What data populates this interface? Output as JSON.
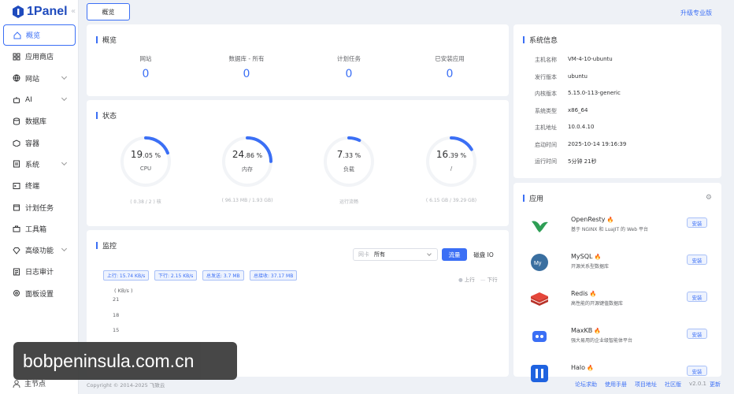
{
  "app": {
    "brand": "1Panel",
    "accent": "#3b6ff5"
  },
  "sidebar": {
    "items": [
      {
        "label": "概览",
        "icon": "home-icon",
        "active": true,
        "sub": false
      },
      {
        "label": "应用商店",
        "icon": "grid-icon",
        "sub": false
      },
      {
        "label": "网站",
        "icon": "globe-icon",
        "sub": true
      },
      {
        "label": "AI",
        "icon": "robot-icon",
        "sub": true
      },
      {
        "label": "数据库",
        "icon": "database-icon",
        "sub": false
      },
      {
        "label": "容器",
        "icon": "container-icon",
        "sub": false
      },
      {
        "label": "系统",
        "icon": "system-icon",
        "sub": true
      },
      {
        "label": "终端",
        "icon": "terminal-icon",
        "sub": false
      },
      {
        "label": "计划任务",
        "icon": "calendar-icon",
        "sub": false
      },
      {
        "label": "工具箱",
        "icon": "toolbox-icon",
        "sub": false
      },
      {
        "label": "高级功能",
        "icon": "diamond-icon",
        "sub": true
      },
      {
        "label": "日志审计",
        "icon": "log-icon",
        "sub": false
      },
      {
        "label": "面板设置",
        "icon": "settings-icon",
        "sub": false
      }
    ],
    "user": "主节点"
  },
  "topbar": {
    "breadcrumb": "概览",
    "upgrade": "升级专业版"
  },
  "overview": {
    "title": "概览",
    "items": [
      {
        "label": "网站",
        "value": "0"
      },
      {
        "label": "数据库 - 所有",
        "value": "0"
      },
      {
        "label": "计划任务",
        "value": "0"
      },
      {
        "label": "已安装应用",
        "value": "0"
      }
    ]
  },
  "status": {
    "title": "状态",
    "gauges": [
      {
        "int": "19",
        "dec": ".05 %",
        "label": "CPU",
        "sub": "( 0.38 / 2 ) 核",
        "percent": 19.05
      },
      {
        "int": "24",
        "dec": ".86 %",
        "label": "内存",
        "sub": "( 96.13 MB / 1.93 GB)",
        "percent": 24.86
      },
      {
        "int": "7",
        "dec": ".33 %",
        "label": "负载",
        "sub": "运行流畅",
        "percent": 7.33
      },
      {
        "int": "16",
        "dec": ".39 %",
        "label": "/",
        "sub": "( 6.15 GB / 39.29 GB)",
        "percent": 16.39
      }
    ]
  },
  "monitor": {
    "title": "监控",
    "select_prefix": "网卡",
    "select_value": "所有",
    "tab_active": "流量",
    "tab_other": "磁盘 IO",
    "tags": [
      "上行: 15.74 KB/s",
      "下行: 2.15 KB/s",
      "总发送: 3.7 MB",
      "总接收: 37.17 MB"
    ],
    "legend_up": "上行",
    "legend_down": "下行",
    "yunit": "( KB/s )",
    "yticks": [
      "21",
      "18",
      "15"
    ]
  },
  "sysinfo": {
    "title": "系统信息",
    "rows": [
      {
        "k": "主机名称",
        "v": "VM-4-10-ubuntu"
      },
      {
        "k": "发行版本",
        "v": "ubuntu"
      },
      {
        "k": "内核版本",
        "v": "5.15.0-113-generic"
      },
      {
        "k": "系统类型",
        "v": "x86_64"
      },
      {
        "k": "主机地址",
        "v": "10.0.4.10"
      },
      {
        "k": "启动时间",
        "v": "2025-10-14 19:16:39"
      },
      {
        "k": "运行时间",
        "v": "5分钟 21秒"
      }
    ]
  },
  "apps": {
    "title": "应用",
    "install": "安装",
    "items": [
      {
        "name": "OpenResty",
        "desc": "基于 NGINX 和 LuaJIT 的 Web 平台",
        "icon": "openresty-icon",
        "color": "#2e9e55"
      },
      {
        "name": "MySQL",
        "desc": "开源关系型数据库",
        "icon": "mysql-icon",
        "color": "#3a6fa0"
      },
      {
        "name": "Redis",
        "desc": "高性能的开源键值数据库",
        "icon": "redis-icon",
        "color": "#d03a2e"
      },
      {
        "name": "MaxKB",
        "desc": "强大易用的企业级智能体平台",
        "icon": "maxkb-icon",
        "color": "#3b6ff5"
      },
      {
        "name": "Halo",
        "desc": "",
        "icon": "halo-icon",
        "color": "#1f63e0"
      }
    ]
  },
  "footer": {
    "copyright": "Copyright © 2014-2025 飞致云",
    "links": [
      "论坛求助",
      "使用手册",
      "项目地址",
      "社区版"
    ],
    "version": "v2.0.1",
    "update": "更新"
  },
  "watermark": "bobpeninsula.com.cn"
}
